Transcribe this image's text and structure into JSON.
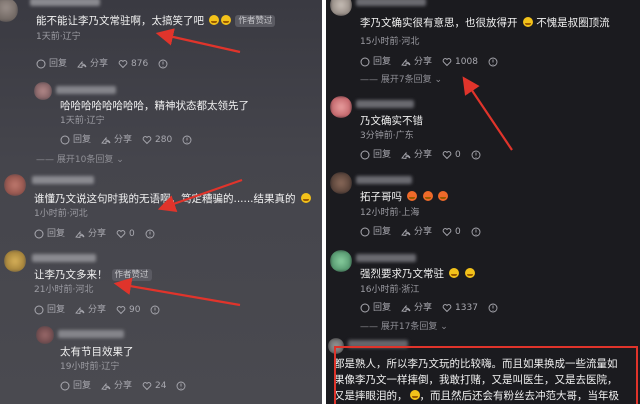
{
  "left": {
    "comments": [
      {
        "text": "能不能让李乃文常驻啊，太搞笑了吧",
        "badge": "作者赞过",
        "meta": "1天前·辽宁",
        "reply": "回复",
        "share": "分享",
        "likes": "876"
      },
      {
        "text": "哈哈哈哈哈哈哈哈，精神状态都太领先了",
        "meta": "1天前·辽宁",
        "reply": "回复",
        "share": "分享",
        "likes": "280"
      },
      {
        "more": "展开10条回复"
      },
      {
        "text": "谁懂乃文说这句时我的无语啊，笃定糟骗的......结果真的",
        "meta": "1小时前·河北",
        "reply": "回复",
        "share": "分享",
        "likes": "0"
      },
      {
        "text": "让李乃文多来！",
        "badge": "作者赞过",
        "meta": "21小时前·河北",
        "reply": "回复",
        "share": "分享",
        "likes": "90"
      },
      {
        "text": "太有节目效果了",
        "meta": "19小时前·辽宁",
        "reply": "回复",
        "share": "分享",
        "likes": "24"
      }
    ]
  },
  "right": {
    "comments": [
      {
        "text": "李乃文确实很有意思，也很放得开",
        "text2": "不愧是叔圈顶流",
        "meta": "15小时前·河北",
        "reply": "回复",
        "share": "分享",
        "likes": "1008"
      },
      {
        "more": "展开7条回复"
      },
      {
        "text": "乃文确实不错",
        "meta": "3分钟前·广东",
        "reply": "回复",
        "share": "分享",
        "likes": "0"
      },
      {
        "text": "拓子哥吗",
        "meta": "12小时前·上海",
        "reply": "回复",
        "share": "分享",
        "likes": "0"
      },
      {
        "text": "强烈要求乃文常驻",
        "meta": "16小时前·浙江",
        "reply": "回复",
        "share": "分享",
        "likes": "1337"
      },
      {
        "more": "展开17条回复"
      },
      {
        "line1": "都是熟人，所以李乃文玩的比较嗨。而且如果换成一些流量如",
        "line2": "果像李乃文一样摔倒，我敢打赌，又是叫医生，又是去医院，",
        "line3": "又是摔眼泪的，",
        "line3b": "，而且然后还会有粉丝去冲范大哥，当年极"
      }
    ]
  },
  "colors": {
    "arrow": "#e0342b",
    "highlight": "#e0342b"
  }
}
